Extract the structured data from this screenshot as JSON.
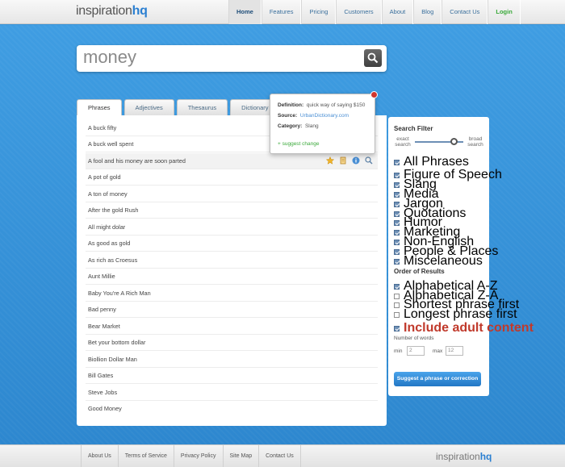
{
  "brand": {
    "name": "inspiration",
    "suffix": "hq"
  },
  "nav": [
    "Home",
    "Features",
    "Pricing",
    "Customers",
    "About",
    "Blog",
    "Contact Us",
    "Login"
  ],
  "search": {
    "query": "money"
  },
  "tabs": [
    "Phrases",
    "Adjectives",
    "Thesaurus",
    "Dictionary"
  ],
  "results": [
    "A buck fifty",
    "A buck well spent",
    "A fool and his money are soon parted",
    "A pot of gold",
    "A ton of money",
    "After the gold Rush",
    "All might dolar",
    "As good as gold",
    "As rich as Croesus",
    "Aunt Millie",
    "Baby You're A Rich Man",
    "Bad penny",
    "Bear Market",
    "Bet your bottom dollar",
    "Biollion Dollar Man",
    "Bill Gates",
    "Steve Jobs",
    "Good Money"
  ],
  "tooltip": {
    "def_label": "Definition:",
    "def_value": "quick way of saying $150",
    "src_label": "Source:",
    "src_value": "UrbanDictionary.com",
    "cat_label": "Category:",
    "cat_value": "Slang",
    "suggest": "+ suggest change"
  },
  "filter": {
    "title": "Search Filter",
    "exact": "exact search",
    "broad": "broad search",
    "all": "All Phrases",
    "categories": [
      "Figure of Speech",
      "Slang",
      "Media",
      "Jargon",
      "Quotations",
      "Humor",
      "Marketing",
      "Non-English",
      "People & Places",
      "Miscelaneous"
    ],
    "order_title": "Order of Results",
    "orders": [
      "Alphabetical A-Z",
      "Alphabetical Z-A",
      "Shortest phrase first",
      "Longest phrase first"
    ],
    "adult": "Include adult content",
    "words_label": "Number of words",
    "min_label": "min",
    "min_value": "2",
    "max_label": "max",
    "max_value": "12",
    "suggest_button": "Suggest a phrase or correction"
  },
  "footer": [
    "About Us",
    "Terms of Service",
    "Privacy Policy",
    "Site Map",
    "Contact Us"
  ],
  "colors": {
    "accent": "#2a7fd1",
    "background": "#3a93d6",
    "login": "#3aa93a",
    "adult": "#c0392b"
  }
}
